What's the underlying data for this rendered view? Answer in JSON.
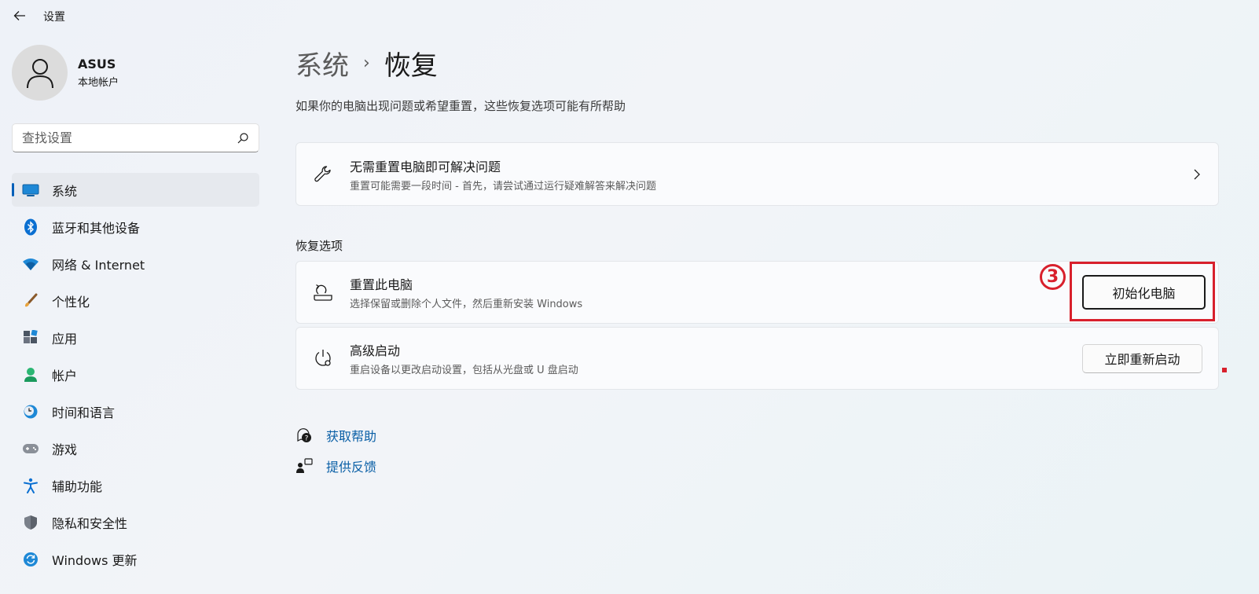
{
  "window": {
    "title": "设置"
  },
  "profile": {
    "name": "ASUS",
    "account_type": "本地帐户"
  },
  "search": {
    "placeholder": "查找设置"
  },
  "sidebar": {
    "items": [
      {
        "label": "系统",
        "icon": "system-icon",
        "active": true
      },
      {
        "label": "蓝牙和其他设备",
        "icon": "bluetooth-icon"
      },
      {
        "label": "网络 & Internet",
        "icon": "wifi-icon"
      },
      {
        "label": "个性化",
        "icon": "brush-icon"
      },
      {
        "label": "应用",
        "icon": "apps-icon"
      },
      {
        "label": "帐户",
        "icon": "account-icon"
      },
      {
        "label": "时间和语言",
        "icon": "clock-globe-icon"
      },
      {
        "label": "游戏",
        "icon": "gamepad-icon"
      },
      {
        "label": "辅助功能",
        "icon": "accessibility-icon"
      },
      {
        "label": "隐私和安全性",
        "icon": "shield-icon"
      },
      {
        "label": "Windows 更新",
        "icon": "update-icon"
      }
    ]
  },
  "breadcrumb": {
    "parent": "系统",
    "current": "恢复"
  },
  "description": "如果你的电脑出现问题或希望重置，这些恢复选项可能有所帮助",
  "troubleshoot_card": {
    "title": "无需重置电脑即可解决问题",
    "subtitle": "重置可能需要一段时间 - 首先，请尝试通过运行疑难解答来解决问题",
    "icon": "wrench-icon"
  },
  "recovery_section": {
    "label": "恢复选项",
    "reset_pc": {
      "title": "重置此电脑",
      "subtitle": "选择保留或删除个人文件，然后重新安装 Windows",
      "button": "初始化电脑",
      "icon": "reset-icon"
    },
    "advanced_startup": {
      "title": "高级启动",
      "subtitle": "重启设备以更改启动设置，包括从光盘或 U 盘启动",
      "button": "立即重新启动",
      "icon": "advanced-startup-icon"
    }
  },
  "links": [
    {
      "label": "获取帮助",
      "icon": "help-icon"
    },
    {
      "label": "提供反馈",
      "icon": "feedback-icon"
    }
  ],
  "annotation": {
    "step_number": "3",
    "color": "#d8202c"
  },
  "colors": {
    "accent": "#005fb8",
    "link": "#0a5fa6"
  }
}
